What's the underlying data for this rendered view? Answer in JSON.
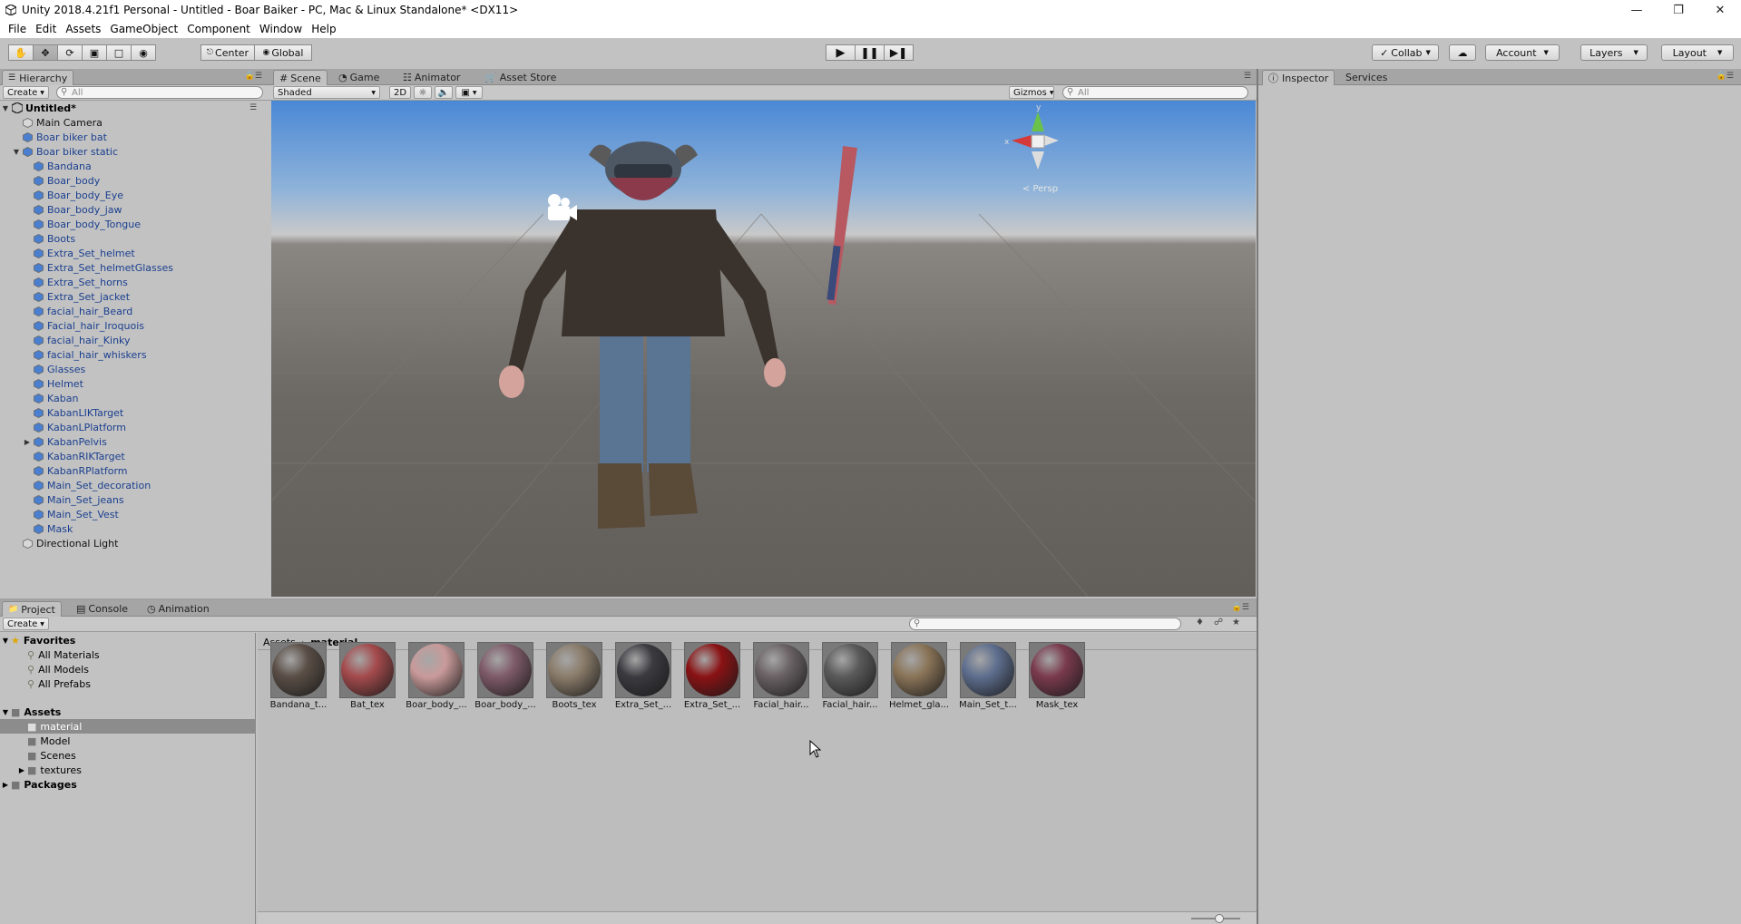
{
  "window": {
    "title": "Unity 2018.4.21f1 Personal - Untitled - Boar Baiker - PC, Mac & Linux Standalone* <DX11>"
  },
  "menu": [
    "File",
    "Edit",
    "Assets",
    "GameObject",
    "Component",
    "Window",
    "Help"
  ],
  "toolbar": {
    "pivot_label": "Center",
    "space_label": "Global",
    "collab_label": "Collab",
    "account_label": "Account",
    "layers_label": "Layers",
    "layout_label": "Layout"
  },
  "hierarchy": {
    "tab_label": "Hierarchy",
    "create_label": "Create",
    "search_placeholder": "All",
    "scene_name": "Untitled*",
    "items": [
      {
        "label": "Main Camera",
        "depth": 1,
        "color": "black"
      },
      {
        "label": "Boar biker bat",
        "depth": 1,
        "color": "blue"
      },
      {
        "label": "Boar biker static",
        "depth": 1,
        "color": "blue",
        "expanded": true
      },
      {
        "label": "Bandana",
        "depth": 2,
        "color": "blue"
      },
      {
        "label": "Boar_body",
        "depth": 2,
        "color": "blue"
      },
      {
        "label": "Boar_body_Eye",
        "depth": 2,
        "color": "blue"
      },
      {
        "label": "Boar_body_jaw",
        "depth": 2,
        "color": "blue"
      },
      {
        "label": "Boar_body_Tongue",
        "depth": 2,
        "color": "blue"
      },
      {
        "label": "Boots",
        "depth": 2,
        "color": "blue"
      },
      {
        "label": "Extra_Set_helmet",
        "depth": 2,
        "color": "blue"
      },
      {
        "label": "Extra_Set_helmetGlasses",
        "depth": 2,
        "color": "blue"
      },
      {
        "label": "Extra_Set_horns",
        "depth": 2,
        "color": "blue"
      },
      {
        "label": "Extra_Set_jacket",
        "depth": 2,
        "color": "blue"
      },
      {
        "label": "facial_hair_Beard",
        "depth": 2,
        "color": "blue"
      },
      {
        "label": "Facial_hair_Iroquois",
        "depth": 2,
        "color": "blue"
      },
      {
        "label": "facial_hair_Kinky",
        "depth": 2,
        "color": "blue"
      },
      {
        "label": "facial_hair_whiskers",
        "depth": 2,
        "color": "blue"
      },
      {
        "label": "Glasses",
        "depth": 2,
        "color": "blue"
      },
      {
        "label": "Helmet",
        "depth": 2,
        "color": "blue"
      },
      {
        "label": "Kaban",
        "depth": 2,
        "color": "blue"
      },
      {
        "label": "KabanLIKTarget",
        "depth": 2,
        "color": "blue"
      },
      {
        "label": "KabanLPlatform",
        "depth": 2,
        "color": "blue"
      },
      {
        "label": "KabanPelvis",
        "depth": 2,
        "color": "blue",
        "collapsed": true
      },
      {
        "label": "KabanRIKTarget",
        "depth": 2,
        "color": "blue"
      },
      {
        "label": "KabanRPlatform",
        "depth": 2,
        "color": "blue"
      },
      {
        "label": "Main_Set_decoration",
        "depth": 2,
        "color": "blue"
      },
      {
        "label": "Main_Set_jeans",
        "depth": 2,
        "color": "blue"
      },
      {
        "label": "Main_Set_Vest",
        "depth": 2,
        "color": "blue"
      },
      {
        "label": "Mask",
        "depth": 2,
        "color": "blue"
      },
      {
        "label": "Directional Light",
        "depth": 1,
        "color": "black"
      }
    ]
  },
  "scene": {
    "tabs": [
      "Scene",
      "Game",
      "Animator",
      "Asset Store"
    ],
    "shading_mode": "Shaded",
    "mode_2d_label": "2D",
    "gizmos_label": "Gizmos",
    "search_placeholder": "All",
    "persp_label": "< Persp",
    "gizmo_axes": {
      "x": "x",
      "y": "y"
    }
  },
  "inspector": {
    "tabs": [
      "Inspector",
      "Services"
    ]
  },
  "project": {
    "tabs": [
      "Project",
      "Console",
      "Animation"
    ],
    "create_label": "Create",
    "favorites_label": "Favorites",
    "favorites": [
      "All Materials",
      "All Models",
      "All Prefabs"
    ],
    "assets_label": "Assets",
    "folders": [
      "material",
      "Model",
      "Scenes",
      "textures"
    ],
    "packages_label": "Packages",
    "breadcrumb": [
      "Assets",
      "material"
    ],
    "materials": [
      {
        "label": "Bandana_t...",
        "color": "#5a4e46"
      },
      {
        "label": "Bat_tex",
        "color": "#a44a4c"
      },
      {
        "label": "Boar_body_...",
        "color": "#c99a9a"
      },
      {
        "label": "Boar_body_...",
        "color": "#7e5a68"
      },
      {
        "label": "Boots_tex",
        "color": "#8a7c6a"
      },
      {
        "label": "Extra_Set_...",
        "color": "#3a3a40"
      },
      {
        "label": "Extra_Set_...",
        "color": "#8a1214"
      },
      {
        "label": "Facial_hair...",
        "color": "#6a6264"
      },
      {
        "label": "Facial_hair...",
        "color": "#5a5a5a"
      },
      {
        "label": "Helmet_gla...",
        "color": "#8a7458"
      },
      {
        "label": "Main_Set_t...",
        "color": "#5e6e8e"
      },
      {
        "label": "Mask_tex",
        "color": "#7a3a4e"
      }
    ]
  }
}
